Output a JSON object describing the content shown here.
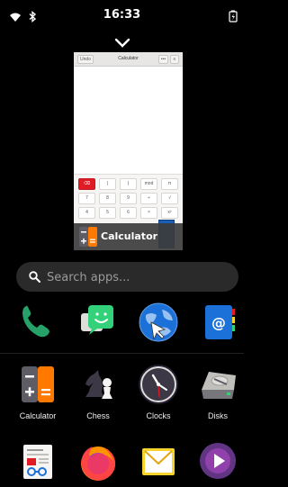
{
  "status": {
    "time": "16:33",
    "icons": [
      "wifi-icon",
      "bluetooth-icon",
      "battery-charging-icon"
    ]
  },
  "window_preview": {
    "header": {
      "undo_label": "Undo",
      "title": "Calculator"
    },
    "keypad": [
      [
        "⌫",
        "(",
        ")",
        "mod",
        "π"
      ],
      [
        "7",
        "8",
        "9",
        "÷",
        "√"
      ],
      [
        "4",
        "5",
        "6",
        "×",
        "x²"
      ]
    ],
    "app_label": "Calculator"
  },
  "search": {
    "placeholder": "Search apps..."
  },
  "apps": {
    "row1": [
      {
        "name": "Calls",
        "icon": "phone-icon",
        "label": ""
      },
      {
        "name": "Chats",
        "icon": "chat-icon",
        "label": ""
      },
      {
        "name": "Web",
        "icon": "globe-icon",
        "label": ""
      },
      {
        "name": "Contacts",
        "icon": "address-book-icon",
        "label": ""
      }
    ],
    "row2": [
      {
        "name": "Calculator",
        "icon": "calculator-icon",
        "label": "Calculator"
      },
      {
        "name": "Chess",
        "icon": "chess-icon",
        "label": "Chess"
      },
      {
        "name": "Clocks",
        "icon": "clock-icon",
        "label": "Clocks"
      },
      {
        "name": "Disks",
        "icon": "disk-icon",
        "label": "Disks"
      }
    ],
    "row3": [
      {
        "name": "Document",
        "icon": "document-viewer-icon",
        "label": ""
      },
      {
        "name": "Firefox",
        "icon": "firefox-icon",
        "label": ""
      },
      {
        "name": "Mail",
        "icon": "mail-icon",
        "label": ""
      },
      {
        "name": "Media",
        "icon": "media-player-icon",
        "label": ""
      }
    ]
  },
  "colors": {
    "background": "#000000",
    "search_bg": "#2a2a2a",
    "calculator_orange": "#ff7800",
    "key_red": "#e01b24",
    "preview_label_bg": "#3c3c3c"
  }
}
